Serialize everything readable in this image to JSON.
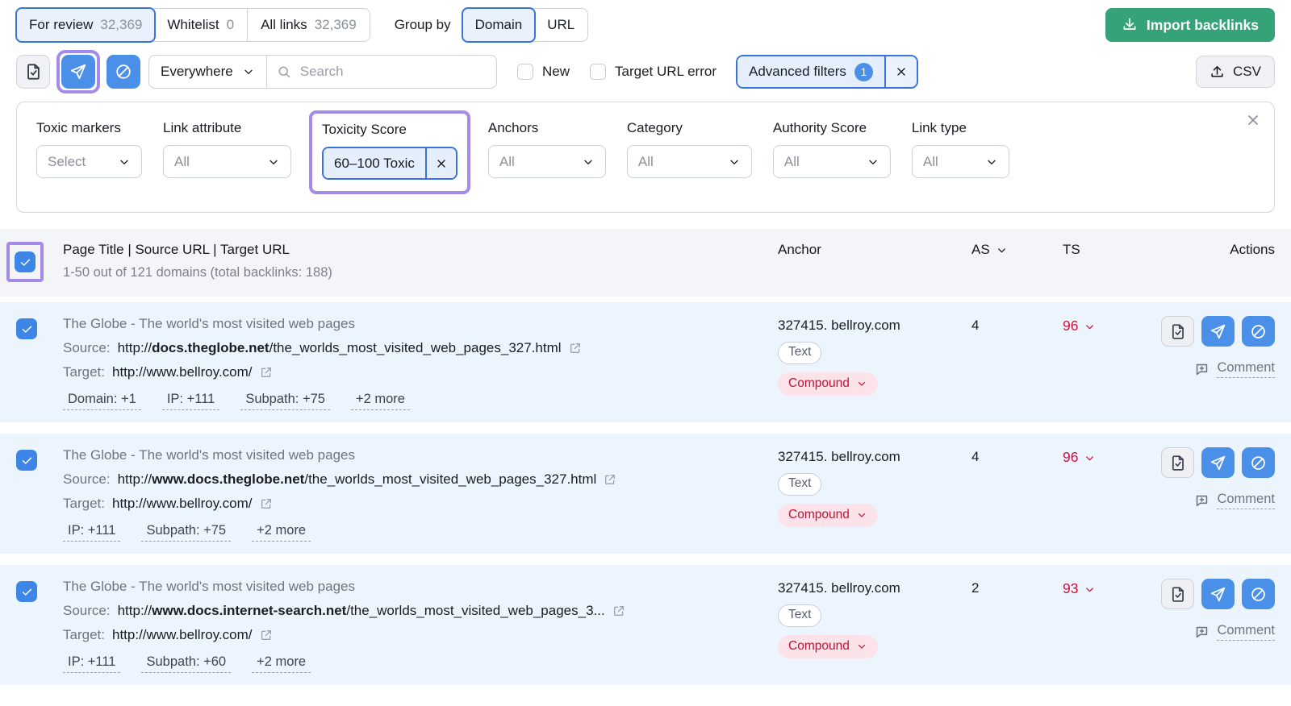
{
  "colors": {
    "accent_blue": "#3b74d9",
    "button_blue": "#4a8fe8",
    "highlight_purple": "#a58be8",
    "toxic_red": "#cf1039",
    "import_green": "#35a277",
    "selected_row_bg": "#ecf5fd",
    "table_header_bg": "#f4f5f9"
  },
  "icons": {
    "whitelist": "doc-check-icon",
    "remove": "paper-plane-icon",
    "disavow": "block-icon",
    "search": "search-icon",
    "import": "download-icon",
    "csv": "upload-icon",
    "external": "external-link-icon",
    "comment": "comment-plus-icon",
    "close": "x-icon",
    "dropdown": "chevron-down-icon"
  },
  "top_bar": {
    "tabs": [
      {
        "label": "For review",
        "count": "32,369"
      },
      {
        "label": "Whitelist",
        "count": "0"
      },
      {
        "label": "All links",
        "count": "32,369"
      }
    ],
    "group_by_label": "Group by",
    "group_by": [
      {
        "label": "Domain"
      },
      {
        "label": "URL"
      }
    ],
    "import_button": "Import backlinks"
  },
  "toolbar": {
    "scope_value": "Everywhere",
    "search_placeholder": "Search",
    "new_checkbox": "New",
    "target_url_error_checkbox": "Target URL error",
    "advanced_filters_label": "Advanced filters",
    "advanced_filters_badge": "1",
    "csv_label": "CSV"
  },
  "filters": {
    "items": [
      {
        "label": "Toxic markers",
        "value": "Select"
      },
      {
        "label": "Link attribute",
        "value": "All"
      },
      {
        "label": "Toxicity Score",
        "value": "60–100 Toxic"
      },
      {
        "label": "Anchors",
        "value": "All"
      },
      {
        "label": "Category",
        "value": "All"
      },
      {
        "label": "Authority Score",
        "value": "All"
      },
      {
        "label": "Link type",
        "value": "All"
      }
    ]
  },
  "table": {
    "header": {
      "title": "Page Title | Source URL | Target URL",
      "subtitle": "1-50 out of 121 domains (total backlinks: 188)",
      "anchor": "Anchor",
      "as": "AS",
      "ts": "TS",
      "actions": "Actions"
    },
    "labels": {
      "source": "Source:",
      "target": "Target:",
      "comment": "Comment"
    },
    "rows": [
      {
        "title": "The Globe - The world's most visited web pages",
        "source_prefix": "http://",
        "source_domain": "docs.theglobe.net",
        "source_path": "/the_worlds_most_visited_web_pages_327.html",
        "target_url": "http://www.bellroy.com/",
        "tags": [
          "Domain: +1",
          "IP: +111",
          "Subpath: +75",
          "+2 more"
        ],
        "anchor": "327415. bellroy.com",
        "anchor_type": "Text",
        "anchor_flag": "Compound",
        "as": "4",
        "ts": "96"
      },
      {
        "title": "The Globe - The world's most visited web pages",
        "source_prefix": "http://",
        "source_domain": "www.docs.theglobe.net",
        "source_path": "/the_worlds_most_visited_web_pages_327.html",
        "target_url": "http://www.bellroy.com/",
        "tags": [
          "IP: +111",
          "Subpath: +75",
          "+2 more"
        ],
        "anchor": "327415. bellroy.com",
        "anchor_type": "Text",
        "anchor_flag": "Compound",
        "as": "4",
        "ts": "96"
      },
      {
        "title": "The Globe - The world's most visited web pages",
        "source_prefix": "http://",
        "source_domain": "www.docs.internet-search.net",
        "source_path": "/the_worlds_most_visited_web_pages_3...",
        "target_url": "http://www.bellroy.com/",
        "tags": [
          "IP: +111",
          "Subpath: +60",
          "+2 more"
        ],
        "anchor": "327415. bellroy.com",
        "anchor_type": "Text",
        "anchor_flag": "Compound",
        "as": "2",
        "ts": "93"
      }
    ]
  }
}
